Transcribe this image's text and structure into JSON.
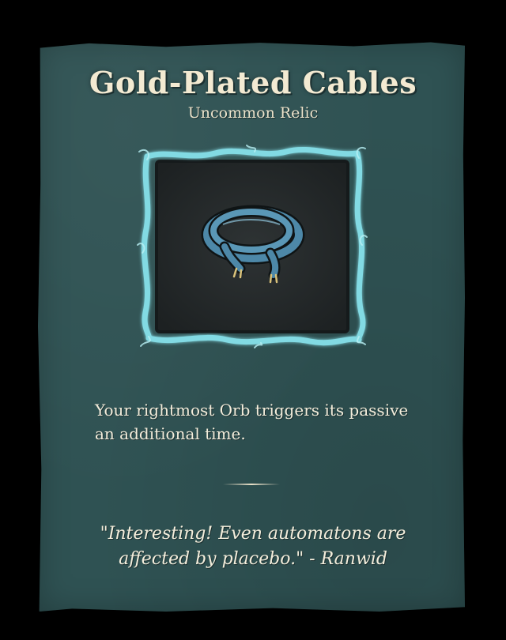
{
  "relic": {
    "name": "Gold-Plated Cables",
    "rarity": "Uncommon Relic",
    "icon": "coiled-cable-icon",
    "description": "Your rightmost Orb triggers its passive an additional time.",
    "flavor": "\"Interesting! Even automatons are affected by placebo.\" - Ranwid"
  },
  "colors": {
    "panel": "#2f5253",
    "frame_glow": "#7fd8e0",
    "title_text": "#f3ead2",
    "body_text": "#f4eedc",
    "cable": "#4d88a8"
  }
}
